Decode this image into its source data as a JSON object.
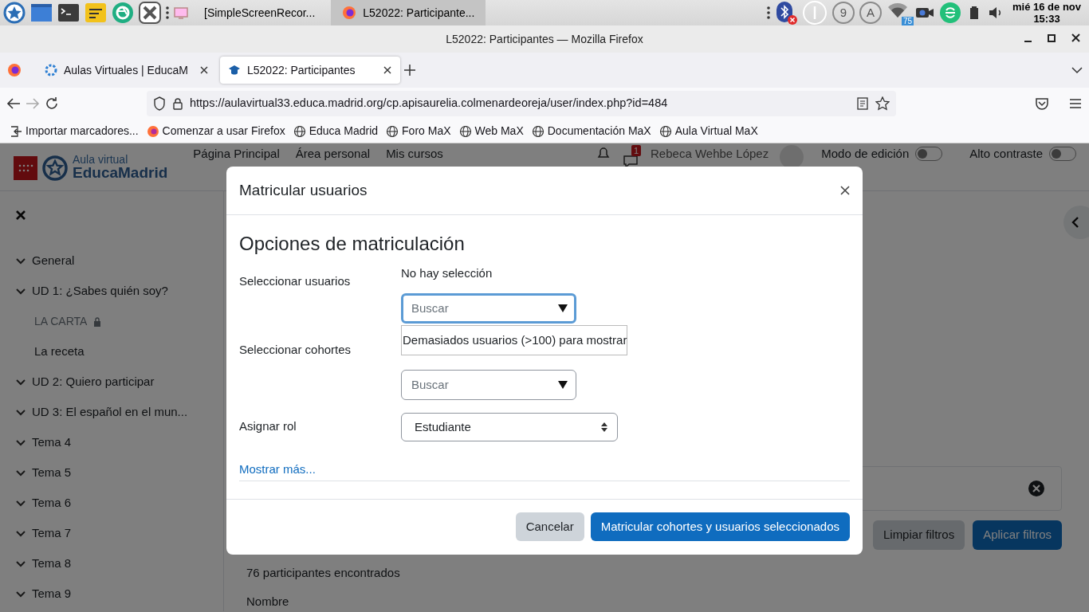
{
  "taskbar": {
    "windows": [
      {
        "title": "[SimpleScreenRecor...",
        "selected": false
      },
      {
        "title": "L52022: Participante...",
        "selected": true
      }
    ],
    "indicators": [
      "9",
      "A"
    ],
    "wifi_badge": "75",
    "clock": {
      "date": "mié 16 de nov",
      "time": "15:33"
    }
  },
  "window": {
    "title": "L52022: Participantes — Mozilla Firefox"
  },
  "tabs": [
    {
      "label": "Aulas Virtuales | EducaM",
      "selected": false
    },
    {
      "label": "L52022: Participantes",
      "selected": true
    }
  ],
  "toolbar": {
    "forward_disabled": true,
    "url": "https://aulavirtual33.educa.madrid.org/cp.apisaurelia.colmenardeoreja/user/index.php?id=484"
  },
  "bookmarks": [
    {
      "label": "Importar marcadores...",
      "kind": "import"
    },
    {
      "label": "Comenzar a usar Firefox",
      "kind": "firefox"
    },
    {
      "label": "Educa Madrid",
      "kind": "globe"
    },
    {
      "label": "Foro MaX",
      "kind": "globe"
    },
    {
      "label": "Web MaX",
      "kind": "globe"
    },
    {
      "label": "Documentación MaX",
      "kind": "globe"
    },
    {
      "label": "Aula Virtual MaX",
      "kind": "globe"
    }
  ],
  "site_header": {
    "logo_small": "Aula virtual",
    "logo_big": "EducaMadrid",
    "nav": [
      "Página Principal",
      "Área personal",
      "Mis cursos"
    ],
    "message_count": "1",
    "user_name": "Rebeca Wehbe López",
    "toggles": [
      {
        "label": "Modo de edición",
        "on": false
      },
      {
        "label": "Alto contraste",
        "on": false
      }
    ]
  },
  "course_index": [
    {
      "label": "General",
      "expanded": true
    },
    {
      "label": "UD 1: ¿Sabes quién soy?",
      "expanded": true,
      "children": [
        {
          "label": "LA CARTA",
          "restricted": true
        },
        {
          "label": "La receta",
          "restricted": false
        }
      ]
    },
    {
      "label": "UD 2: Quiero participar",
      "expanded": true
    },
    {
      "label": "UD 3: El español en el mun...",
      "expanded": true
    },
    {
      "label": "Tema 4",
      "expanded": true
    },
    {
      "label": "Tema 5",
      "expanded": true
    },
    {
      "label": "Tema 6",
      "expanded": true
    },
    {
      "label": "Tema 7",
      "expanded": true
    },
    {
      "label": "Tema 8",
      "expanded": true
    },
    {
      "label": "Tema 9",
      "expanded": true
    }
  ],
  "participants": {
    "filter_buttons": [
      {
        "label": "Limpiar filtros",
        "kind": "secondary"
      },
      {
        "label": "Aplicar filtros",
        "kind": "primary"
      }
    ],
    "count": "76 participantes encontrados",
    "column": "Nombre"
  },
  "modal": {
    "title": "Matricular usuarios",
    "heading": "Opciones de matriculación",
    "fields": [
      {
        "label": "Seleccionar usuarios",
        "kind": "autocomplete",
        "selection": "No hay selección",
        "placeholder": "Buscar",
        "focused": true,
        "suggestion": "Demasiados usuarios (>100) para mostrar"
      },
      {
        "label": "Seleccionar cohortes",
        "kind": "autocomplete",
        "placeholder": "Buscar",
        "focused": false
      },
      {
        "label": "Asignar rol",
        "kind": "select",
        "value": "Estudiante"
      }
    ],
    "more_link": "Mostrar más...",
    "buttons": [
      {
        "label": "Cancelar",
        "kind": "secondary"
      },
      {
        "label": "Matricular cohortes y usuarios seleccionados",
        "kind": "primary"
      }
    ]
  }
}
